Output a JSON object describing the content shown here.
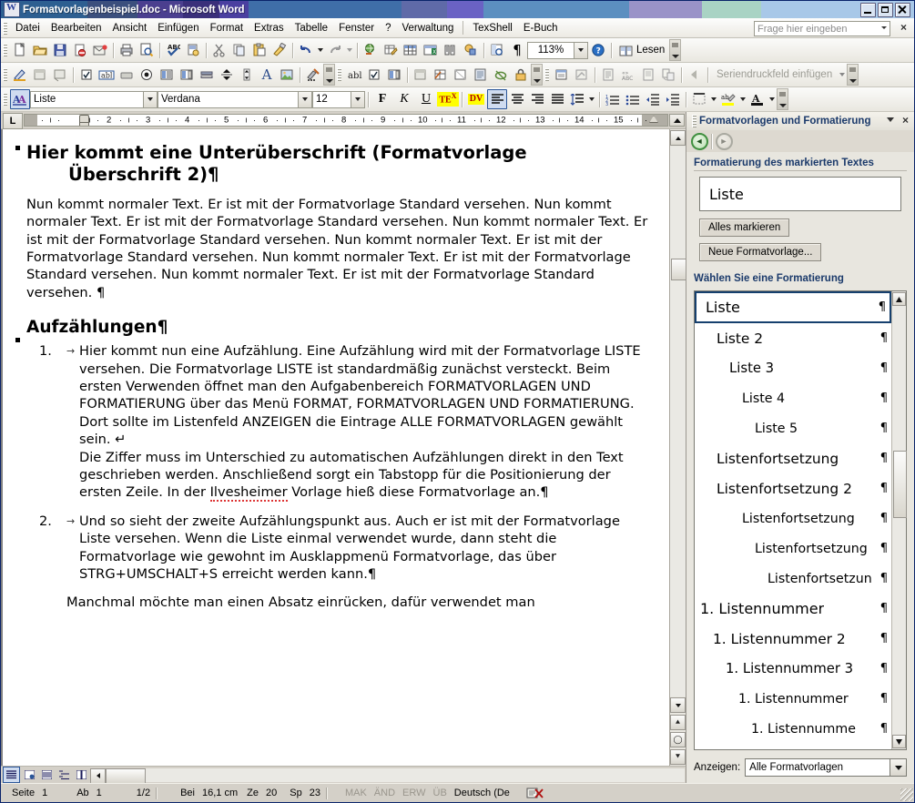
{
  "window": {
    "title": "Formatvorlagenbeispiel.doc - Microsoft Word",
    "icon": "word-document-icon",
    "minimize": "Minimieren",
    "maximize": "Maximieren",
    "close": "Schließen"
  },
  "menubar": {
    "items": [
      {
        "label": "Datei"
      },
      {
        "label": "Bearbeiten"
      },
      {
        "label": "Ansicht"
      },
      {
        "label": "Einfügen"
      },
      {
        "label": "Format"
      },
      {
        "label": "Extras"
      },
      {
        "label": "Tabelle"
      },
      {
        "label": "Fenster"
      },
      {
        "label": "?"
      },
      {
        "label": "Verwaltung"
      },
      {
        "label": "TexShell"
      },
      {
        "label": "E-Buch"
      }
    ],
    "ask_placeholder": "Frage hier eingeben",
    "close_document": "×"
  },
  "toolbar_standard": {
    "buttons": [
      {
        "name": "new-document-icon",
        "title": "Neu"
      },
      {
        "name": "open-folder-icon",
        "title": "Öffnen"
      },
      {
        "name": "save-disk-icon",
        "title": "Speichern"
      },
      {
        "name": "permission-icon",
        "title": "Berechtigung"
      },
      {
        "name": "mail-recipient-icon",
        "title": "E-Mail"
      },
      {
        "name": "print-icon",
        "title": "Drucken"
      },
      {
        "name": "print-preview-icon",
        "title": "Seitenansicht"
      },
      {
        "name": "spellcheck-abc-icon",
        "title": "Rechtschreibung"
      },
      {
        "name": "research-icon",
        "title": "Recherchieren"
      },
      {
        "name": "cut-scissors-icon",
        "title": "Ausschneiden"
      },
      {
        "name": "copy-icon",
        "title": "Kopieren"
      },
      {
        "name": "paste-clipboard-icon",
        "title": "Einfügen"
      },
      {
        "name": "format-painter-brush-icon",
        "title": "Format übertragen"
      },
      {
        "name": "undo-arrow-icon",
        "title": "Rückgängig"
      },
      {
        "name": "redo-arrow-icon",
        "title": "Wiederholen"
      },
      {
        "name": "insert-hyperlink-icon",
        "title": "Hyperlink einfügen"
      },
      {
        "name": "tables-and-borders-icon",
        "title": "Tabellen und Rahmen"
      },
      {
        "name": "insert-table-icon",
        "title": "Tabelle einfügen"
      },
      {
        "name": "insert-excel-sheet-icon",
        "title": "Excel-Tabelle einfügen"
      },
      {
        "name": "columns-icon",
        "title": "Spalten"
      },
      {
        "name": "drawing-icon",
        "title": "Zeichnen"
      },
      {
        "name": "document-map-icon",
        "title": "Dokumentstruktur"
      },
      {
        "name": "pilcrow-show-formatting-icon",
        "title": "Formatierungszeichen"
      }
    ],
    "zoom_value": "113%",
    "help_icon": "help-question-icon",
    "read_label": "Lesen",
    "read_icon": "read-book-icon"
  },
  "toolbar_forms": {
    "buttons": [
      {
        "name": "design-mode-pencil-icon"
      },
      {
        "name": "properties-icon"
      },
      {
        "name": "view-code-icon"
      },
      {
        "name": "checkbox-control-icon"
      },
      {
        "name": "textbox-control-icon"
      },
      {
        "name": "command-button-icon"
      },
      {
        "name": "option-button-icon"
      },
      {
        "name": "listbox-control-icon"
      },
      {
        "name": "combobox-control-icon"
      },
      {
        "name": "toggle-button-icon"
      },
      {
        "name": "spin-button-icon"
      },
      {
        "name": "scrollbar-control-icon"
      },
      {
        "name": "label-control-icon"
      },
      {
        "name": "image-control-icon"
      },
      {
        "name": "more-controls-icon"
      }
    ],
    "buttons2": [
      {
        "name": "text-form-field-icon"
      },
      {
        "name": "checkbox-form-field-icon"
      },
      {
        "name": "dropdown-form-field-icon"
      },
      {
        "name": "form-field-options-icon"
      },
      {
        "name": "draw-table-icon"
      },
      {
        "name": "insert-frame-icon"
      },
      {
        "name": "form-shading-icon"
      },
      {
        "name": "reset-form-fields-icon"
      },
      {
        "name": "protect-form-lock-icon"
      }
    ],
    "buttons3": [
      {
        "name": "insert-word-field-icon"
      },
      {
        "name": "view-merged-data-icon"
      },
      {
        "name": "highlight-merge-fields-icon"
      },
      {
        "name": "match-fields-icon"
      },
      {
        "name": "propagate-labels-icon"
      },
      {
        "name": "check-errors-icon"
      },
      {
        "name": "first-record-icon"
      }
    ],
    "mailmerge_label": "Seriendruckfeld einfügen"
  },
  "toolbar_formatting": {
    "style_icon": "styles-and-formatting-icon",
    "style_value": "Liste",
    "font_value": "Verdana",
    "size_value": "12",
    "bold_label": "F",
    "italic_label": "K",
    "underline_label": "U",
    "subscript_label": "TE",
    "superscript_label": "X",
    "dv_label": "DV",
    "align_left": "align-left-icon",
    "align_center": "align-center-icon",
    "align_right": "align-right-icon",
    "align_justify": "align-justify-icon",
    "line_spacing": "line-spacing-icon",
    "numbered_list": "numbered-list-icon",
    "bulleted_list": "bulleted-list-icon",
    "decrease_indent": "decrease-indent-icon",
    "increase_indent": "increase-indent-icon",
    "borders": "borders-icon",
    "highlight": "highlight-color-icon",
    "font_color": "font-color-icon"
  },
  "ruler": {
    "tab_selector": "L",
    "ticks": [
      "1",
      "2",
      "3",
      "4",
      "5",
      "6",
      "7",
      "8",
      "9",
      "10",
      "11",
      "12",
      "13",
      "14",
      "15"
    ],
    "left_indent_marker": "first-line-indent-marker",
    "right_indent_marker": "right-indent-marker"
  },
  "document": {
    "heading1": "Hier kommt eine Unterüberschrift (Formatvorlage",
    "heading1_line2": "Überschrift 2)¶",
    "paragraph1": "Nun kommt normaler Text. Er ist mit der Formatvorlage Standard versehen. Nun kommt normaler Text. Er ist mit der Formatvorlage Standard versehen. Nun kommt normaler Text. Er ist mit der Formatvorlage Standard versehen. Nun kommt normaler Text. Er ist mit der Formatvorlage Standard versehen. Nun kommt normaler Text. Er ist mit der Formatvorlage Standard versehen. Nun kommt normaler Text. Er ist mit der Formatvorlage Standard versehen. ¶",
    "heading2": "Aufzählungen¶",
    "list": [
      {
        "number": "1.",
        "tab": "→",
        "text": "Hier kommt nun eine Aufzählung. Eine Aufzählung wird mit der Formatvorlage LISTE versehen. Die Formatvorlage LISTE ist standardmäßig zunächst versteckt. Beim ersten Verwenden öffnet man den Aufgabenbereich FORMATVORLAGEN UND FORMATIERUNG über das Menü FORMAT, FORMATVORLAGEN UND FORMATIERUNG. Dort sollte im Listenfeld ANZEIGEN die Eintrage ALLE FORMATVORLAGEN gewählt sein. ↵",
        "text2_a": "Die Ziffer muss im Unterschied zu automatischen Aufzählungen direkt in den Text geschrieben werden. Anschließend sorgt ein Tabstopp für die Positionierung der ersten Zeile. In der ",
        "text2_misspelled": "Ilvesheimer",
        "text2_b": " Vorlage hieß diese Formatvorlage an.¶"
      },
      {
        "number": "2.",
        "tab": "→",
        "text": "Und so sieht der zweite Aufzählungspunkt aus. Auch er ist mit der Formatvorlage Liste versehen. Wenn die Liste einmal verwendet wurde, dann steht die Formatvorlage wie gewohnt im Ausklappmenü Formatvorlage, das über STRG+UMSCHALT+S erreicht werden kann.¶"
      }
    ],
    "trailing_paragraph": "Manchmal möchte man einen Absatz einrücken, dafür verwendet man"
  },
  "task_pane": {
    "title": "Formatvorlagen und Formatierung",
    "back_icon": "back-arrow-icon",
    "forward_icon": "forward-arrow-icon",
    "section1_title": "Formatierung des markierten Textes",
    "selected_format": "Liste",
    "select_all_button": "Alles markieren",
    "new_style_button": "Neue Formatvorlage...",
    "section2_title": "Wählen Sie eine Formatierung",
    "styles": [
      {
        "label": "Liste",
        "indent": 0,
        "selected": true,
        "prefix": "",
        "mark": "¶"
      },
      {
        "label": "Liste 2",
        "indent": 1,
        "selected": false,
        "prefix": "",
        "mark": "¶"
      },
      {
        "label": "Liste 3",
        "indent": 2,
        "selected": false,
        "prefix": "",
        "mark": "¶"
      },
      {
        "label": "Liste 4",
        "indent": 3,
        "selected": false,
        "prefix": "",
        "mark": "¶"
      },
      {
        "label": "Liste 5",
        "indent": 4,
        "selected": false,
        "prefix": "",
        "mark": "¶"
      },
      {
        "label": "Listenfortsetzung",
        "indent": 1,
        "selected": false,
        "prefix": "",
        "mark": "¶"
      },
      {
        "label": "Listenfortsetzung 2",
        "indent": 1,
        "selected": false,
        "prefix": "",
        "mark": "¶"
      },
      {
        "label": "Listenfortsetzung",
        "indent": 3,
        "selected": false,
        "prefix": "",
        "mark": "¶"
      },
      {
        "label": "Listenfortsetzung",
        "indent": 4,
        "selected": false,
        "prefix": "",
        "mark": "¶"
      },
      {
        "label": "Listenfortsetzun",
        "indent": 5,
        "selected": false,
        "prefix": "",
        "mark": "¶"
      },
      {
        "label": "Listennummer",
        "indent": 0,
        "selected": false,
        "prefix": "1.",
        "mark": "¶"
      },
      {
        "label": "Listennummer 2",
        "indent": 1,
        "selected": false,
        "prefix": "1.",
        "mark": "¶"
      },
      {
        "label": "Listennummer 3",
        "indent": 2,
        "selected": false,
        "prefix": "1.",
        "mark": "¶"
      },
      {
        "label": "Listennummer",
        "indent": 3,
        "selected": false,
        "prefix": "1.",
        "mark": "¶"
      },
      {
        "label": "Listennumme",
        "indent": 4,
        "selected": false,
        "prefix": "1.",
        "mark": "¶"
      }
    ],
    "show_label": "Anzeigen:",
    "show_value": "Alle Formatvorlagen"
  },
  "view_buttons": [
    {
      "name": "normal-view-icon",
      "selected": true
    },
    {
      "name": "web-layout-view-icon",
      "selected": false
    },
    {
      "name": "print-layout-view-icon",
      "selected": false
    },
    {
      "name": "outline-view-icon",
      "selected": false
    },
    {
      "name": "reading-layout-view-icon",
      "selected": false
    }
  ],
  "status_bar": {
    "page_label": "Seite",
    "page_value": "1",
    "section_label": "Ab",
    "section_value": "1",
    "page_of": "1/2",
    "at_label": "Bei",
    "at_value": "16,1 cm",
    "line_label": "Ze",
    "line_value": "20",
    "col_label": "Sp",
    "col_value": "23",
    "mak": "MAK",
    "and": "ÄND",
    "erw": "ERW",
    "ub": "ÜB",
    "language": "Deutsch (De",
    "spell_icon": "spelling-status-icon"
  },
  "colors": {
    "title_start": "#2d5f91",
    "title_end": "#a8c8e8",
    "accent_blue": "#1b3a6b",
    "face": "#d4d0c8",
    "toolbar": "#ece9e0",
    "selection_border": "#16406e",
    "highlight_yellow": "#ffff00"
  }
}
